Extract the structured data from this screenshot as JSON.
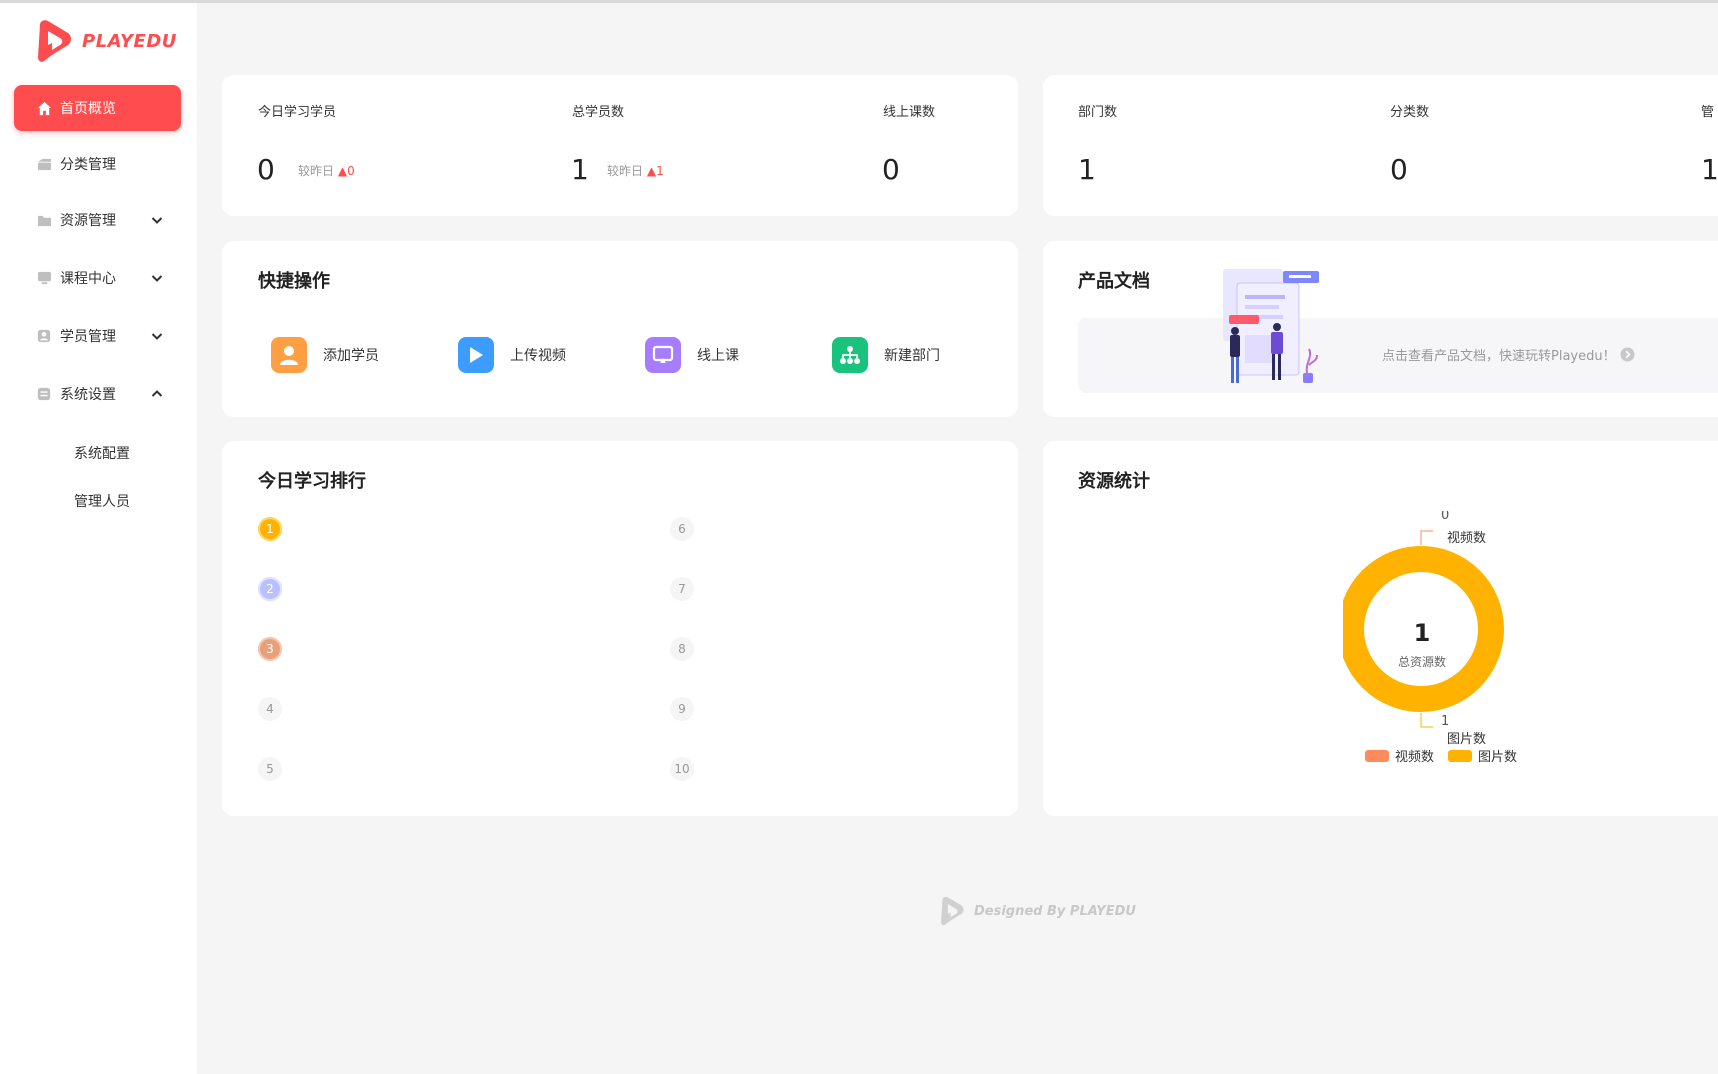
{
  "brand": {
    "name": "PLAYEDU"
  },
  "sidebar": {
    "items": [
      {
        "label": "首页概览",
        "icon": "home-icon",
        "active": true
      },
      {
        "label": "分类管理",
        "icon": "category-icon"
      },
      {
        "label": "资源管理",
        "icon": "folder-icon",
        "arrow": "down"
      },
      {
        "label": "课程中心",
        "icon": "course-icon",
        "arrow": "down"
      },
      {
        "label": "学员管理",
        "icon": "user-icon",
        "arrow": "down"
      },
      {
        "label": "系统设置",
        "icon": "settings-icon",
        "arrow": "up"
      }
    ],
    "sub_items": [
      "系统配置",
      "管理人员"
    ]
  },
  "stats_card_1": {
    "today_learners": {
      "label": "今日学习学员",
      "value": "0",
      "compare_label": "较昨日",
      "compare_value": "▲0"
    },
    "total_learners": {
      "label": "总学员数",
      "value": "1",
      "compare_label": "较昨日",
      "compare_value": "▲1"
    },
    "online_courses": {
      "label": "线上课数",
      "value": "0"
    }
  },
  "stats_card_2": {
    "departments": {
      "label": "部门数",
      "value": "1"
    },
    "categories": {
      "label": "分类数",
      "value": "0"
    },
    "admins": {
      "label": "管",
      "value": "1"
    }
  },
  "quick_actions": {
    "title": "快捷操作",
    "items": [
      {
        "label": "添加学员",
        "icon": "add-user-icon",
        "color": "#ff9f43"
      },
      {
        "label": "上传视频",
        "icon": "upload-video-icon",
        "color": "#3c9cff"
      },
      {
        "label": "线上课",
        "icon": "online-course-icon",
        "color": "#a77dff"
      },
      {
        "label": "新建部门",
        "icon": "department-icon",
        "color": "#19c37d"
      }
    ]
  },
  "product_docs": {
    "title": "产品文档",
    "link_text": "点击查看产品文档，快速玩转Playedu！"
  },
  "ranking": {
    "title": "今日学习排行",
    "ranks": [
      "1",
      "2",
      "3",
      "4",
      "5",
      "6",
      "7",
      "8",
      "9",
      "10"
    ]
  },
  "resource_stats": {
    "title": "资源统计",
    "total_value": "1",
    "total_label": "总资源数",
    "top_value": "0",
    "top_label": "视频数",
    "bottom_value": "1",
    "bottom_label": "图片数",
    "legend": [
      {
        "label": "视频数",
        "color": "#ff8b5c"
      },
      {
        "label": "图片数",
        "color": "#ffb300"
      }
    ]
  },
  "footer": {
    "text": "Designed By PLAYEDU"
  },
  "colors": {
    "accent": "#ff4d4f",
    "donut": "#ffb300"
  }
}
